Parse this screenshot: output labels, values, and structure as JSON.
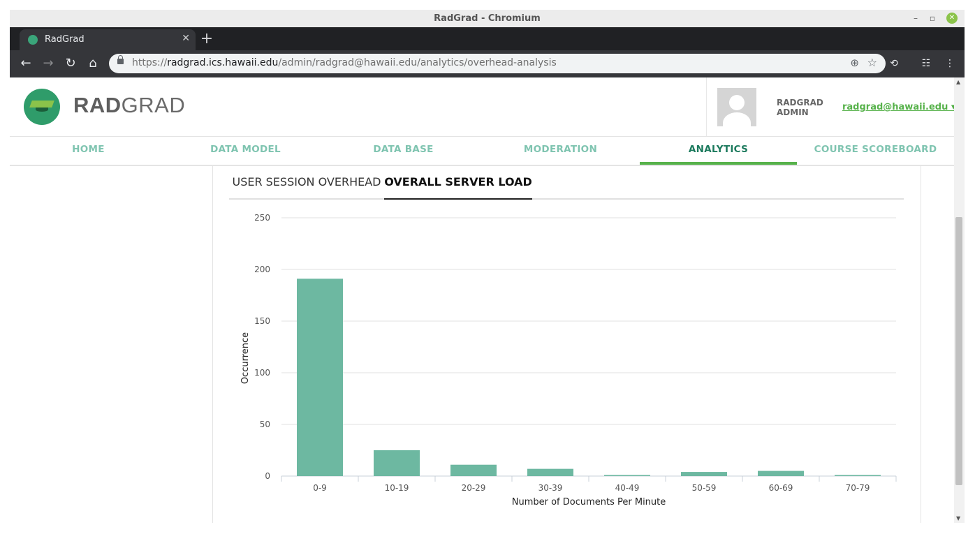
{
  "window": {
    "title": "RadGrad - Chromium"
  },
  "browser": {
    "tab_title": "RadGrad",
    "url_prefix": "https://",
    "url_host": "radgrad.ics.hawaii.edu",
    "url_path": "/admin/radgrad@hawaii.edu/analytics/overhead-analysis"
  },
  "header": {
    "brand_bold": "RAD",
    "brand_rest": "GRAD",
    "user_name": "RADGRAD ADMIN",
    "user_email": "radgrad@hawaii.edu ▾"
  },
  "nav": {
    "items": [
      {
        "label": "HOME"
      },
      {
        "label": "DATA MODEL"
      },
      {
        "label": "DATA BASE"
      },
      {
        "label": "MODERATION"
      },
      {
        "label": "ANALYTICS"
      },
      {
        "label": "COURSE SCOREBOARD"
      }
    ],
    "active": "ANALYTICS"
  },
  "subtabs": {
    "items": [
      {
        "label": "USER SESSION OVERHEAD"
      },
      {
        "label": "OVERALL SERVER LOAD"
      }
    ],
    "active": "OVERALL SERVER LOAD"
  },
  "colors": {
    "accent": "#57b24b",
    "bar": "#6db8a1",
    "brand_dark": "#1c7a5d"
  },
  "chart_data": {
    "type": "bar",
    "categories": [
      "0-9",
      "10-19",
      "20-29",
      "30-39",
      "40-49",
      "50-59",
      "60-69",
      "70-79"
    ],
    "values": [
      191,
      25,
      11,
      7,
      1,
      4,
      5,
      1
    ],
    "xlabel": "Number of Documents Per Minute",
    "ylabel": "Occurrence",
    "ylim": [
      0,
      250
    ],
    "yticks": [
      0,
      50,
      100,
      150,
      200,
      250
    ],
    "grid": true
  }
}
